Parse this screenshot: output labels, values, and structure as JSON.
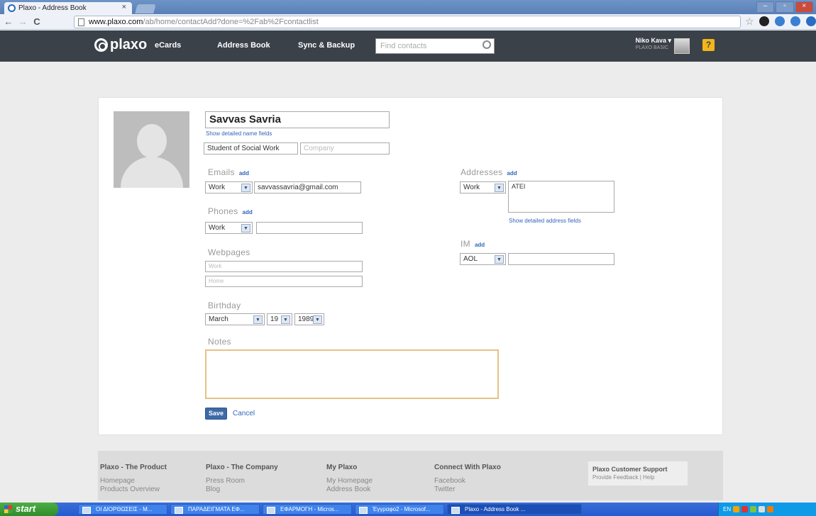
{
  "browser": {
    "tab_title": "Plaxo - Address Book",
    "tab_close": "×",
    "url_host": "www.plaxo.com",
    "url_path": "/ab/home/contactAdd?done=%2Fab%2Fcontactlist",
    "window_controls": [
      "–",
      "▫",
      "×"
    ]
  },
  "header": {
    "logo": "plaxo",
    "nav": {
      "ecards": "eCards",
      "address_book": "Address Book",
      "sync_backup": "Sync & Backup"
    },
    "search_placeholder": "Find contacts",
    "user_name": "Niko Kava ▾",
    "user_sub": "PLAXO BASIC",
    "help": "?"
  },
  "contact": {
    "name": "Savvas Savria",
    "show_name_fields": "Show detailed name fields",
    "title": "Student of Social Work",
    "company_placeholder": "Company",
    "emails_label": "Emails",
    "email_type": "Work",
    "email_value": "savvassavria@gmail.com",
    "phones_label": "Phones",
    "phone_type": "Work",
    "webpages_label": "Webpages",
    "webpage_work_placeholder": "Work",
    "webpage_home_placeholder": "Home",
    "birthday_label": "Birthday",
    "birthday_month": "March",
    "birthday_day": "19",
    "birthday_year": "1989",
    "notes_label": "Notes",
    "addresses_label": "Addresses",
    "address_type": "Work",
    "address_value": "ATEI",
    "show_address_fields": "Show detailed address fields",
    "im_label": "IM",
    "im_type": "AOL",
    "add": "add",
    "save": "Save",
    "cancel": "Cancel"
  },
  "footer": {
    "col1": {
      "head": "Plaxo - The Product",
      "links": [
        "Homepage",
        "Products Overview"
      ]
    },
    "col2": {
      "head": "Plaxo - The Company",
      "links": [
        "Press Room",
        "Blog"
      ]
    },
    "col3": {
      "head": "My Plaxo",
      "links": [
        "My Homepage",
        "Address Book"
      ]
    },
    "col4": {
      "head": "Connect With Plaxo",
      "links": [
        "Facebook",
        "Twitter"
      ]
    },
    "support_title": "Plaxo Customer Support",
    "support_links": "Provide Feedback | Help"
  },
  "taskbar": {
    "start": "start",
    "tasks": [
      "ΟΙ ΔΙΟΡΘΩΣΕΙΣ - Μ...",
      "ΠΑΡΑΔΕΙΓΜΑΤΑ ΕΦ...",
      "ΕΦΑΡΜΟΓΗ - Micros...",
      "Έγγραφο2 - Microsof...",
      "Plaxo - Address Book ..."
    ],
    "lang": "EN"
  },
  "colors": {
    "header_bg": "#3b4149",
    "link": "#3366bb",
    "save_button": "#3d6aa8",
    "help": "#f2b51a"
  }
}
